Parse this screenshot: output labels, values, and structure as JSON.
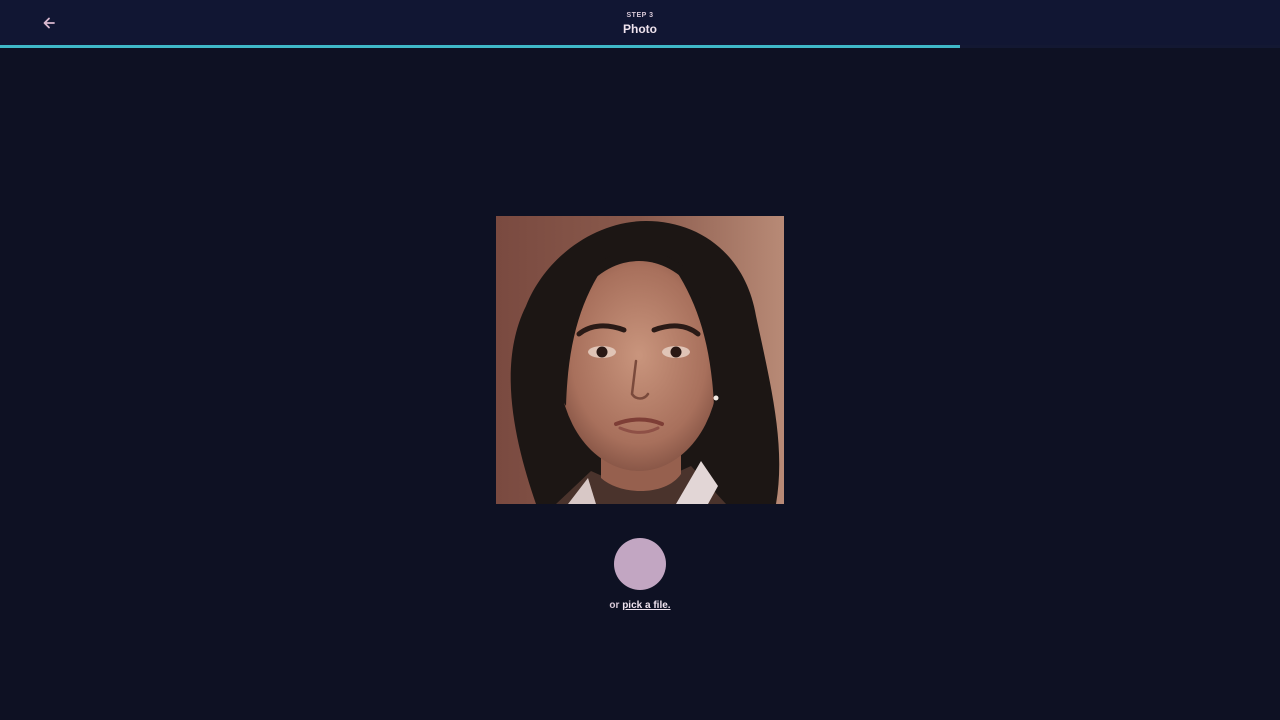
{
  "header": {
    "step_label": "STEP 3",
    "title": "Photo",
    "back_icon": "arrow-left-icon"
  },
  "progress": {
    "fraction": 0.75,
    "color": "#3fb8c8"
  },
  "photo": {
    "kind": "portrait-photo"
  },
  "capture": {
    "icon": "capture-circle",
    "color": "#c2a6c2"
  },
  "alt_action": {
    "prefix": "or",
    "link_label": "pick a file."
  },
  "colors": {
    "background": "#0e1123",
    "header_background": "#111633",
    "accent": "#3fb8c8"
  }
}
